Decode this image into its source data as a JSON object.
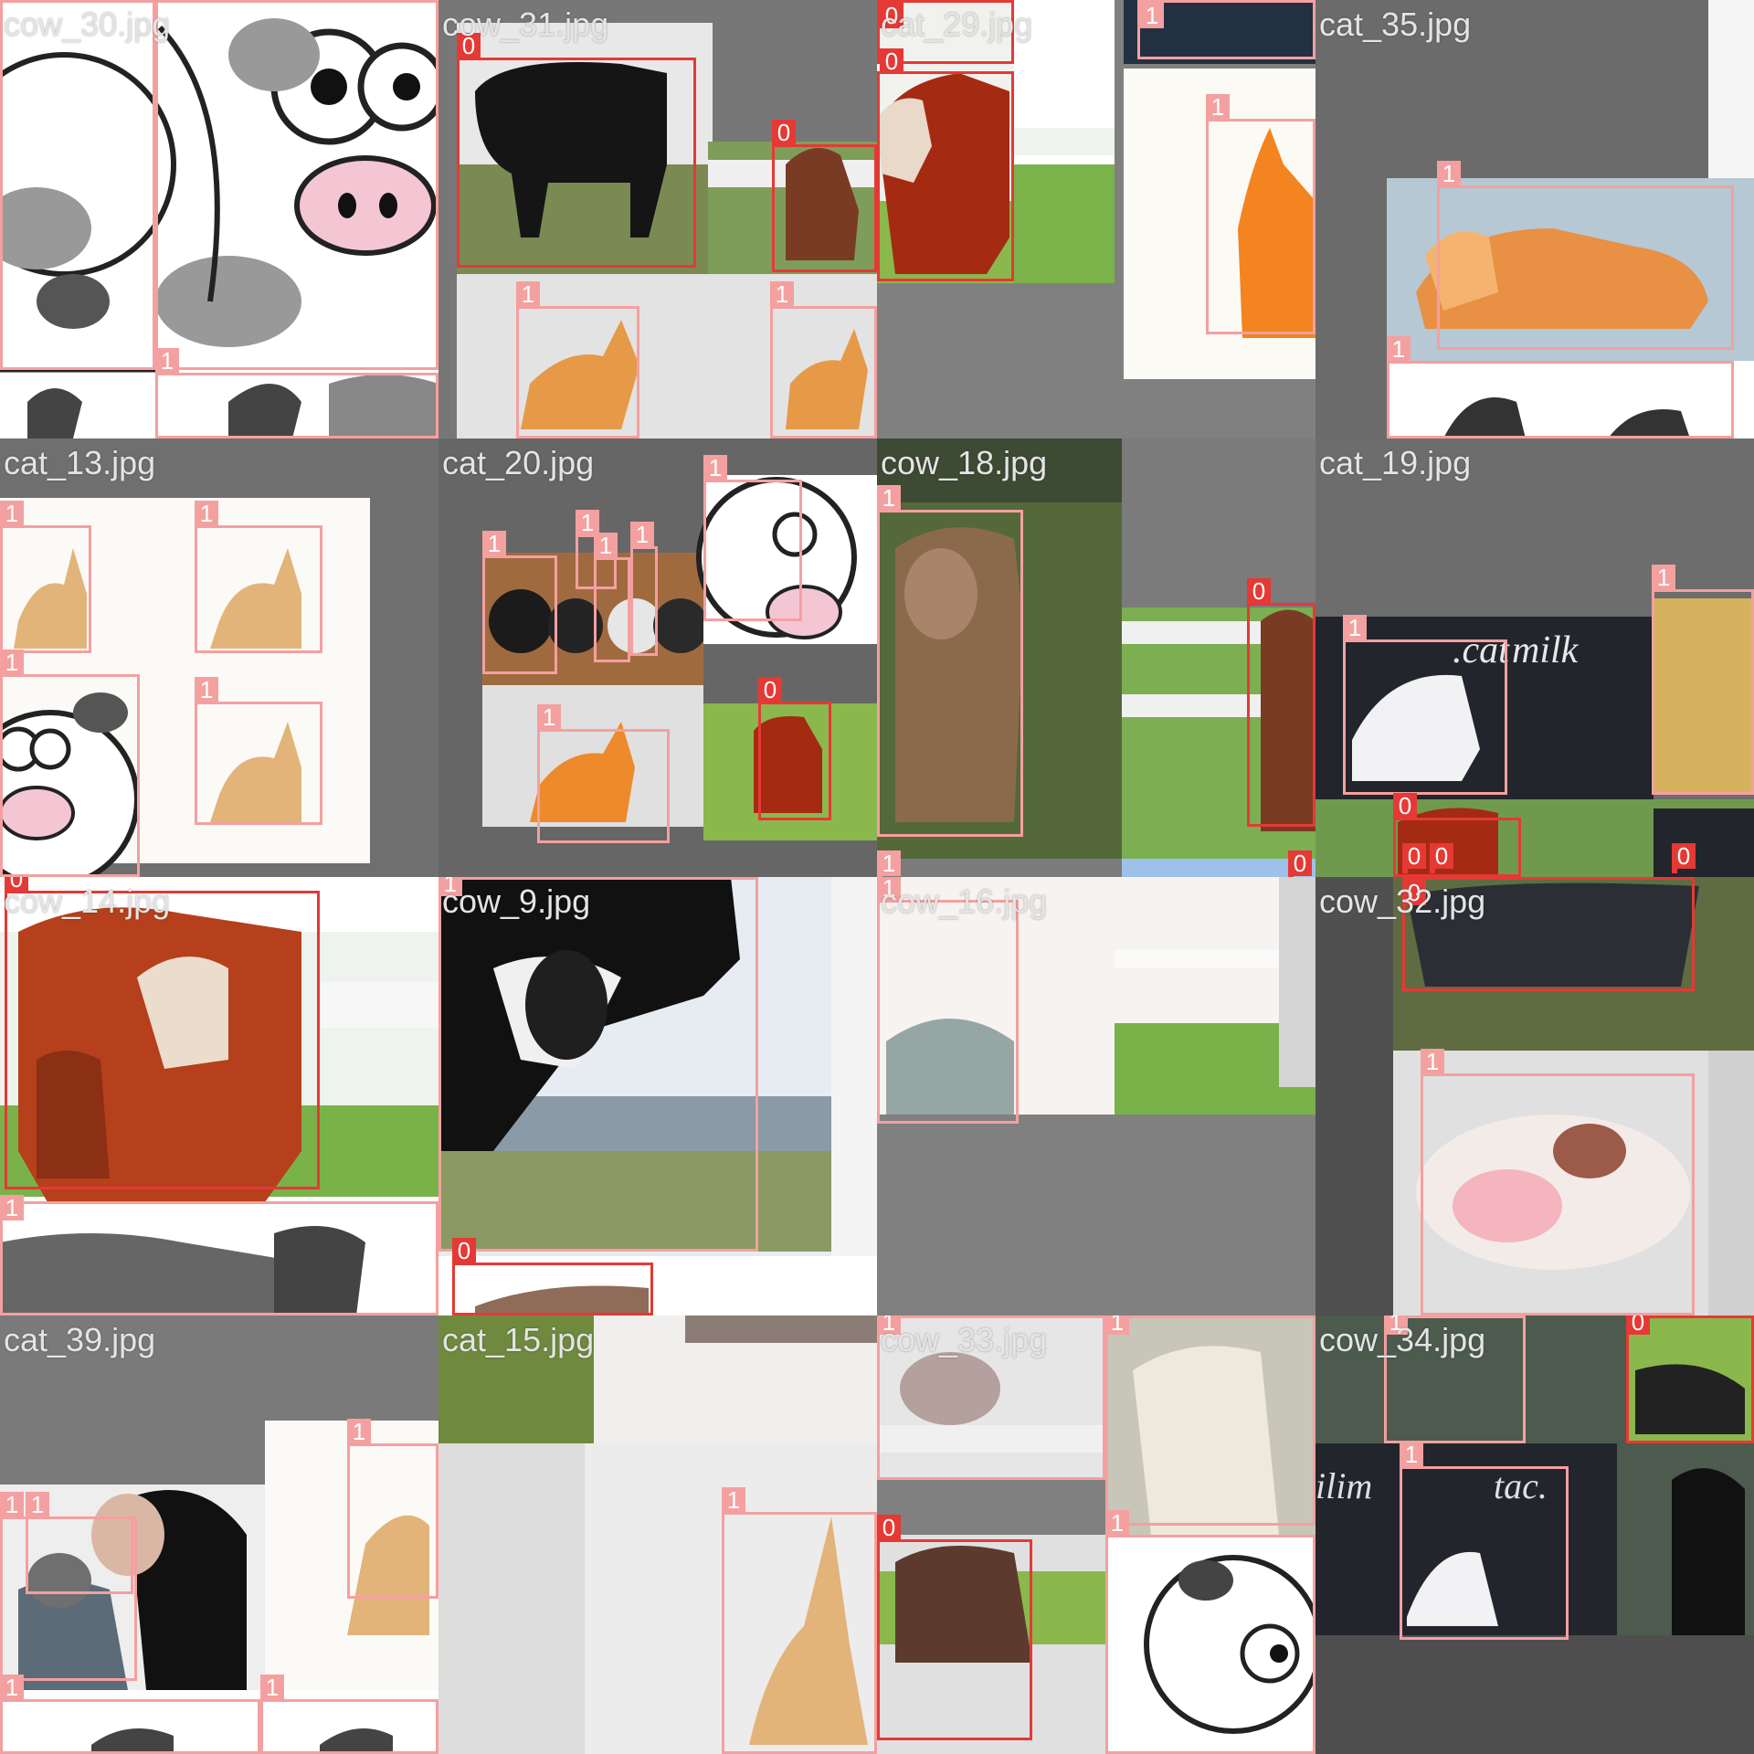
{
  "colors": {
    "class_0": "#e53935",
    "class_1": "#f4a0a0",
    "tile_bg": "#808080"
  },
  "tiles": [
    {
      "filename": "cow_30.jpg",
      "scene": "cartoon-cow",
      "boxes": [
        {
          "cls": "1",
          "label": "1"
        },
        {
          "cls": "1",
          "label": "1"
        },
        {
          "cls": "1",
          "label": "1"
        }
      ]
    },
    {
      "filename": "cow_31.jpg",
      "scene": "black-cow",
      "boxes": [
        {
          "cls": "0",
          "label": "0"
        },
        {
          "cls": "0",
          "label": "0"
        },
        {
          "cls": "1",
          "label": "1"
        },
        {
          "cls": "1",
          "label": "1"
        }
      ]
    },
    {
      "filename": "cat_29.jpg",
      "scene": "hereford",
      "boxes": [
        {
          "cls": "0",
          "label": "0"
        },
        {
          "cls": "0",
          "label": "0"
        },
        {
          "cls": "1",
          "label": "1"
        },
        {
          "cls": "1",
          "label": "1"
        }
      ]
    },
    {
      "filename": "cat_35.jpg",
      "scene": "sleeping-cat",
      "boxes": [
        {
          "cls": "1",
          "label": "1"
        },
        {
          "cls": "1",
          "label": "1"
        }
      ]
    },
    {
      "filename": "cat_13.jpg",
      "scene": "cats-white",
      "boxes": [
        {
          "cls": "1",
          "label": "1"
        },
        {
          "cls": "1",
          "label": "1"
        },
        {
          "cls": "1",
          "label": "1"
        },
        {
          "cls": "1",
          "label": "1"
        }
      ]
    },
    {
      "filename": "cat_20.jpg",
      "scene": "kittens",
      "boxes": [
        {
          "cls": "1",
          "label": "1"
        },
        {
          "cls": "1",
          "label": "1"
        },
        {
          "cls": "1",
          "label": "1"
        },
        {
          "cls": "1",
          "label": "1"
        },
        {
          "cls": "1",
          "label": "1"
        },
        {
          "cls": "1",
          "label": "1"
        },
        {
          "cls": "1",
          "label": "1"
        },
        {
          "cls": "0",
          "label": "0"
        }
      ]
    },
    {
      "filename": "cow_18.jpg",
      "scene": "highland",
      "boxes": [
        {
          "cls": "1",
          "label": "1"
        },
        {
          "cls": "0",
          "label": "0"
        },
        {
          "cls": "1",
          "label": "1"
        },
        {
          "cls": "0",
          "label": "0"
        }
      ]
    },
    {
      "filename": "cat_19.jpg",
      "scene": "white-kitten",
      "boxes": [
        {
          "cls": "1",
          "label": "1"
        },
        {
          "cls": "1",
          "label": "1"
        },
        {
          "cls": "0",
          "label": "0"
        },
        {
          "cls": "0",
          "label": "0"
        },
        {
          "cls": "0",
          "label": "0"
        },
        {
          "cls": "0",
          "label": "0"
        }
      ]
    },
    {
      "filename": "cow_14.jpg",
      "scene": "cow-calf",
      "boxes": [
        {
          "cls": "0",
          "label": "0"
        },
        {
          "cls": "1",
          "label": "1"
        }
      ]
    },
    {
      "filename": "cow_9.jpg",
      "scene": "holstein",
      "boxes": [
        {
          "cls": "1",
          "label": "1"
        },
        {
          "cls": "0",
          "label": "0"
        }
      ]
    },
    {
      "filename": "cow_16.jpg",
      "scene": "fence",
      "boxes": [
        {
          "cls": "1",
          "label": "1"
        }
      ]
    },
    {
      "filename": "cow_32.jpg",
      "scene": "lying-cow",
      "boxes": [
        {
          "cls": "0",
          "label": "0"
        },
        {
          "cls": "1",
          "label": "1"
        }
      ]
    },
    {
      "filename": "cat_39.jpg",
      "scene": "woman-cat",
      "boxes": [
        {
          "cls": "1",
          "label": "1"
        },
        {
          "cls": "1",
          "label": "1"
        },
        {
          "cls": "1",
          "label": "1"
        },
        {
          "cls": "1",
          "label": "1"
        },
        {
          "cls": "1",
          "label": "1"
        }
      ]
    },
    {
      "filename": "cat_15.jpg",
      "scene": "blur-cat",
      "boxes": [
        {
          "cls": "1",
          "label": "1"
        }
      ]
    },
    {
      "filename": "cow_33.jpg",
      "scene": "mixed-cows",
      "boxes": [
        {
          "cls": "1",
          "label": "1"
        },
        {
          "cls": "1",
          "label": "1"
        },
        {
          "cls": "0",
          "label": "0"
        },
        {
          "cls": "1",
          "label": "1"
        }
      ]
    },
    {
      "filename": "cow_34.jpg",
      "scene": "kitten-woman",
      "boxes": [
        {
          "cls": "1",
          "label": "1"
        },
        {
          "cls": "0",
          "label": "0"
        },
        {
          "cls": "1",
          "label": "1"
        }
      ]
    }
  ]
}
